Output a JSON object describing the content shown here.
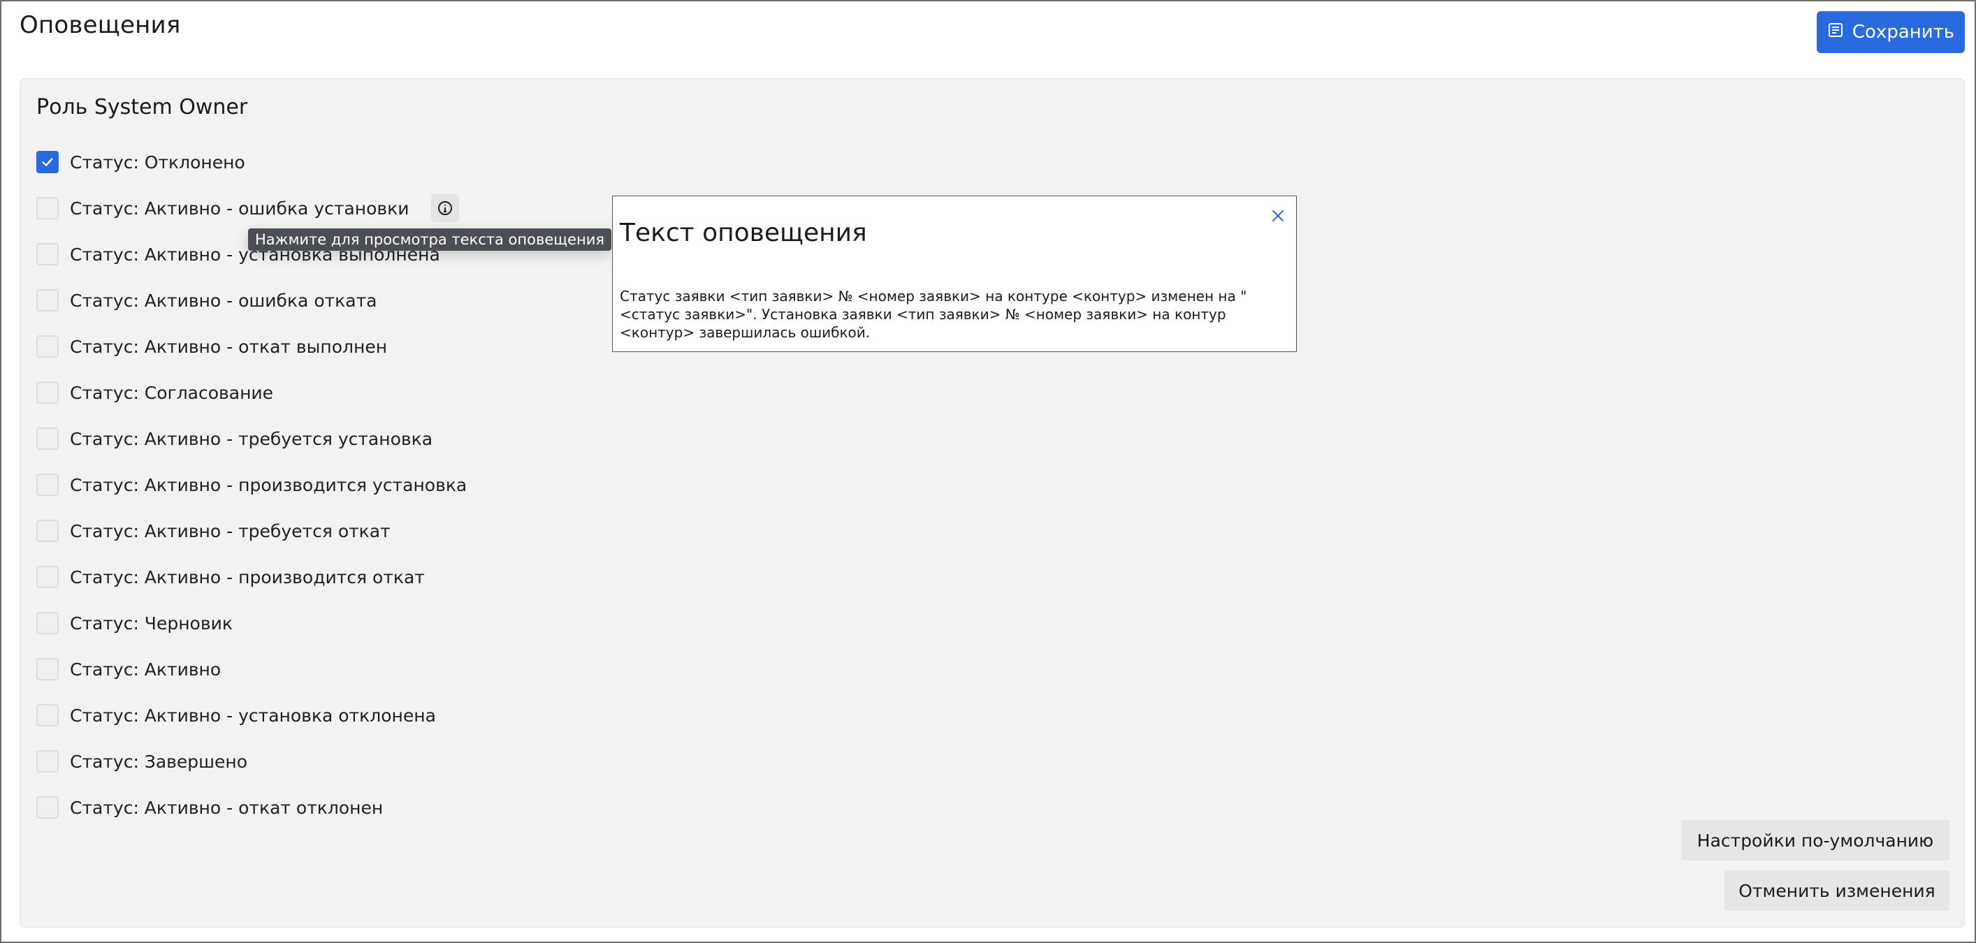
{
  "page": {
    "title": "Оповещения"
  },
  "toolbar": {
    "save_label": "Сохранить"
  },
  "role": {
    "title": "Роль System Owner"
  },
  "statuses": [
    {
      "label": "Статус: Отклонено",
      "checked": true
    },
    {
      "label": "Статус: Активно - ошибка установки",
      "checked": false,
      "has_info": true
    },
    {
      "label": "Статус: Активно - установка выполнена",
      "checked": false
    },
    {
      "label": "Статус: Активно - ошибка отката",
      "checked": false
    },
    {
      "label": "Статус: Активно - откат выполнен",
      "checked": false
    },
    {
      "label": "Статус: Согласование",
      "checked": false
    },
    {
      "label": "Статус: Активно - требуется установка",
      "checked": false
    },
    {
      "label": "Статус: Активно - производится установка",
      "checked": false
    },
    {
      "label": "Статус: Активно - требуется откат",
      "checked": false
    },
    {
      "label": "Статус: Активно - производится откат",
      "checked": false
    },
    {
      "label": "Статус: Черновик",
      "checked": false
    },
    {
      "label": "Статус: Активно",
      "checked": false
    },
    {
      "label": "Статус: Активно - установка отклонена",
      "checked": false
    },
    {
      "label": "Статус: Завершено",
      "checked": false
    },
    {
      "label": "Статус: Активно - откат отклонен",
      "checked": false
    }
  ],
  "tooltip": {
    "text": "Нажмите для просмотра текста оповещения"
  },
  "popup": {
    "title": "Текст оповещения",
    "text": "Статус заявки <тип заявки> № <номер заявки> на контуре <контур> изменен на \"<статус заявки>\". Установка заявки <тип заявки> № <номер заявки> на контур <контур> завершилась ошибкой."
  },
  "footer": {
    "defaults_label": "Настройки по-умолчанию",
    "cancel_label": "Отменить изменения"
  },
  "icons": {
    "save": "save-icon",
    "checkmark": "checkmark-icon",
    "info": "info-icon",
    "close": "close-icon"
  },
  "colors": {
    "accent": "#2a6adf",
    "panel_bg": "#f2f2f2",
    "tooltip_bg": "#4b4f55"
  }
}
